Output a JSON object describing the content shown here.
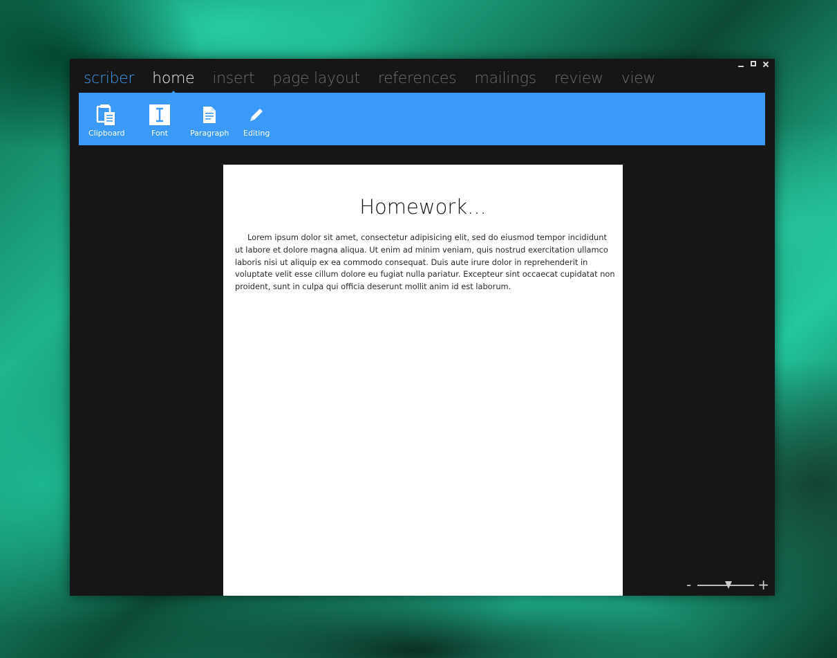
{
  "app": {
    "brand": "scriber",
    "tabs": [
      {
        "label": "home",
        "active": true
      },
      {
        "label": "insert",
        "active": false
      },
      {
        "label": "page layout",
        "active": false
      },
      {
        "label": "references",
        "active": false
      },
      {
        "label": "mailings",
        "active": false
      },
      {
        "label": "review",
        "active": false
      },
      {
        "label": "view",
        "active": false
      }
    ]
  },
  "window_controls": {
    "minimize_icon": "minimize-icon",
    "maximize_icon": "maximize-icon",
    "close_icon": "close-icon"
  },
  "ribbon": {
    "groups": [
      {
        "label": "Clipboard",
        "icon": "clipboard-icon"
      },
      {
        "label": "Font",
        "icon": "font-icon"
      },
      {
        "label": "Paragraph",
        "icon": "paragraph-icon"
      },
      {
        "label": "Editing",
        "icon": "pencil-icon"
      }
    ]
  },
  "document": {
    "title": "Homework...",
    "body": "Lorem ipsum dolor sit amet, consectetur adipisicing elit, sed do eiusmod tempor incididunt ut labore et dolore magna aliqua. Ut enim ad minim veniam, quis nostrud exercitation ullamco laboris nisi ut aliquip ex ea commodo consequat. Duis aute irure dolor in reprehenderit in voluptate velit esse cillum dolore eu fugiat nulla pariatur. Excepteur sint occaecat cupidatat non proident, sunt in culpa qui officia deserunt mollit anim id est laborum."
  },
  "zoom": {
    "minus_label": "-",
    "plus_label": "+",
    "level": 0.55
  },
  "colors": {
    "accent": "#3b99f7",
    "window_bg": "#161616",
    "tab_inactive": "#6e6e6e",
    "tab_active": "#ececec"
  }
}
